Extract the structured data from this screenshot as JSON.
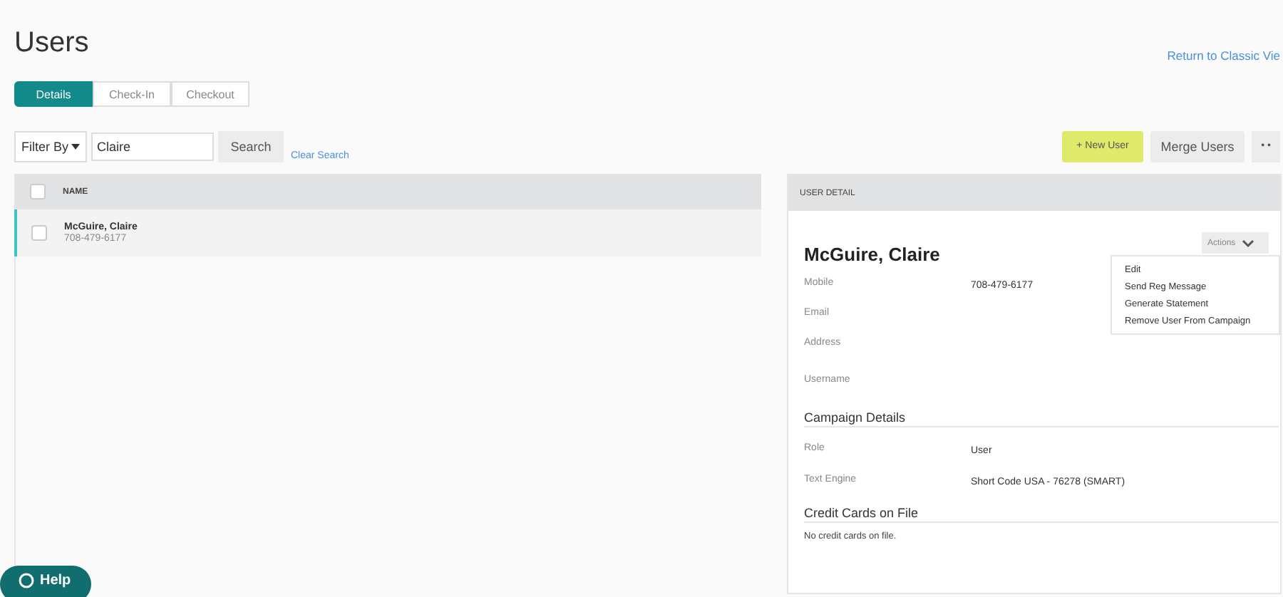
{
  "page": {
    "title": "Users",
    "classic_link": "Return to Classic Vie"
  },
  "tabs": [
    {
      "label": "Details",
      "selected": true
    },
    {
      "label": "Check-In",
      "selected": false
    },
    {
      "label": "Checkout",
      "selected": false
    }
  ],
  "filter": {
    "label": "Filter By",
    "value": "Claire",
    "search_button": "Search",
    "clear_link": "Clear Search"
  },
  "toolbar": {
    "new_user": "+ New User",
    "merge": "Merge Users",
    "more": "• •"
  },
  "list": {
    "header": "NAME",
    "header_checked": false,
    "rows": [
      {
        "name": "McGuire, Claire",
        "phone": "708-479-6177",
        "checked": false,
        "selected": true
      }
    ]
  },
  "detail": {
    "header": "USER DETAIL",
    "name": "McGuire, Claire",
    "actions": "Actions",
    "menu": [
      "Edit",
      "Send Reg Message",
      "Generate Statement",
      "Remove User From Campaign"
    ],
    "fields": [
      {
        "label": "Mobile",
        "value": "708-479-6177"
      },
      {
        "label": "Email"
      },
      {
        "label": "Address"
      },
      {
        "label": "Username"
      }
    ],
    "campaign_heading": "Campaign Details",
    "campaign_fields": [
      {
        "label": "Role",
        "value": "User"
      },
      {
        "label": "Text Engine",
        "value": "Short Code USA - 76278 (SMART)"
      }
    ],
    "cards_heading": "Credit Cards on File",
    "cards_empty": "No credit cards on file."
  },
  "help": {
    "label": "Help"
  }
}
